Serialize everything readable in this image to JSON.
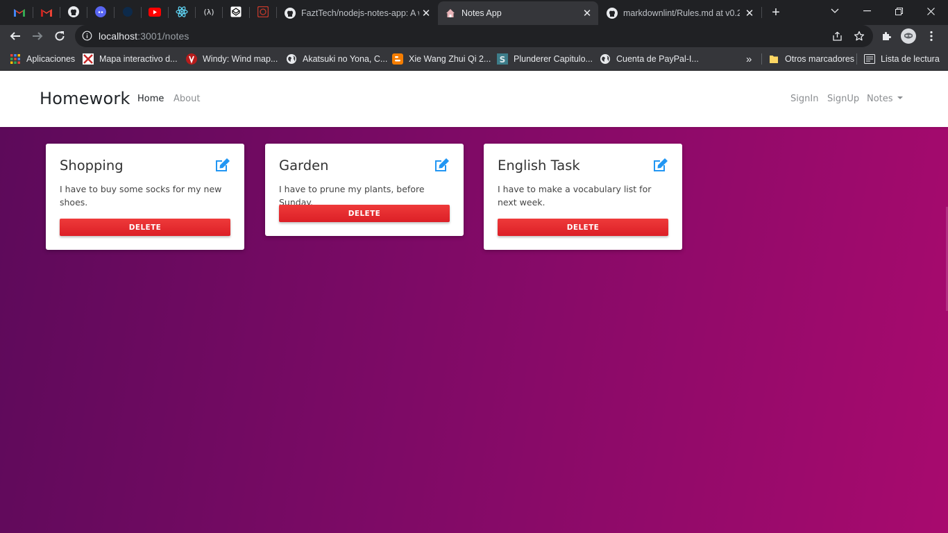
{
  "browser": {
    "tabs": [
      {
        "title": "FaztTech/nodejs-notes-app: A w",
        "active": false
      },
      {
        "title": "Notes App",
        "active": true
      },
      {
        "title": "markdownlint/Rules.md at v0.2",
        "active": false
      }
    ],
    "pinned_icons": [
      "gmail-icon",
      "gmail-icon",
      "github-icon",
      "discord-icon",
      "dark-circle-icon",
      "youtube-icon",
      "react-icon",
      "code-lambda-icon",
      "codepen-icon",
      "red-square-icon"
    ],
    "address": {
      "host": "localhost",
      "path": ":3001/notes"
    },
    "bookmarks": [
      {
        "label": "Aplicaciones",
        "icon": "apps-grid-icon"
      },
      {
        "label": "Mapa interactivo d...",
        "icon": "map-icon"
      },
      {
        "label": "Windy: Wind map...",
        "icon": "windy-icon"
      },
      {
        "label": "Akatsuki no Yona, C...",
        "icon": "globe-icon"
      },
      {
        "label": "Xie Wang Zhui Qi 2...",
        "icon": "blogger-icon"
      },
      {
        "label": "Plunderer Capitulo...",
        "icon": "s-icon"
      },
      {
        "label": "Cuenta de PayPal-I...",
        "icon": "globe-icon"
      }
    ],
    "bookmarks_overflow": "»",
    "other_bookmarks": "Otros marcadores",
    "reading_list": "Lista de lectura"
  },
  "app": {
    "brand": "Homework",
    "nav_left": [
      "Home",
      "About"
    ],
    "nav_right": [
      "SignIn",
      "SignUp",
      "Notes"
    ],
    "active_nav": "Home"
  },
  "notes": [
    {
      "title": "Shopping",
      "description": "I have to buy some socks for my new shoes.",
      "delete_label": "DELETE"
    },
    {
      "title": "Garden",
      "description": "I have to prune my plants, before Sunday.",
      "delete_label": "DELETE"
    },
    {
      "title": "English Task",
      "description": "I have to make a vocabulary list for next week.",
      "delete_label": "DELETE"
    }
  ],
  "colors": {
    "accent_blue": "#2196f3",
    "delete_red": "#e52d2d",
    "gradient_start": "#5c0a5a",
    "gradient_end": "#a80a6e"
  }
}
